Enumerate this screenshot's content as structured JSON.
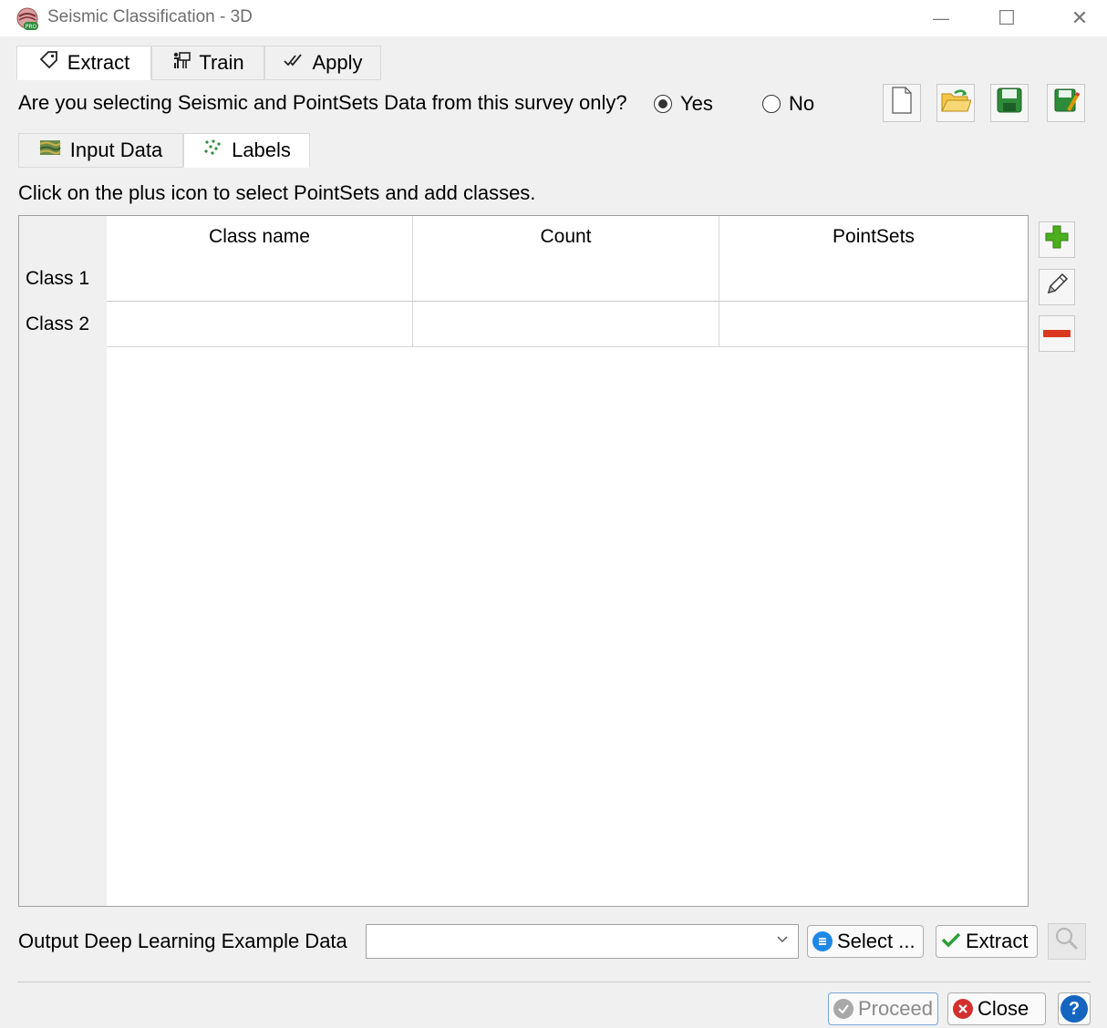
{
  "window": {
    "title": "Seismic Classification - 3D",
    "minimize_glyph": "—",
    "maximize_glyph": "☐",
    "close_glyph": "✕"
  },
  "main_tabs": [
    {
      "label": "Extract",
      "icon": "tag-icon",
      "active": true
    },
    {
      "label": "Train",
      "icon": "train-icon",
      "active": false
    },
    {
      "label": "Apply",
      "icon": "double-check-icon",
      "active": false
    }
  ],
  "survey_question": {
    "text": "Are you selecting Seismic and PointSets Data from this survey only?",
    "options": [
      {
        "label": "Yes",
        "checked": true
      },
      {
        "label": "No",
        "checked": false
      }
    ]
  },
  "toolbar": {
    "buttons": [
      "new-file-icon",
      "open-folder-icon",
      "save-icon",
      "save-as-icon"
    ]
  },
  "sub_tabs": [
    {
      "label": "Input Data",
      "icon": "seismic-data-icon",
      "active": false
    },
    {
      "label": "Labels",
      "icon": "pointset-dots-icon",
      "active": true
    }
  ],
  "instruction": "Click on the plus icon to select PointSets and add classes.",
  "table": {
    "columns": [
      "Class name",
      "Count",
      "PointSets"
    ],
    "rows": [
      {
        "header": "Class 1",
        "cells": [
          "",
          "",
          ""
        ]
      },
      {
        "header": "Class 2",
        "cells": [
          "",
          "",
          ""
        ]
      }
    ]
  },
  "side_buttons": [
    "add-class-icon",
    "edit-icon",
    "remove-class-icon"
  ],
  "output": {
    "label": "Output Deep Learning Example Data",
    "value": "",
    "select_label": "Select ...",
    "extract_label": "Extract"
  },
  "footer": {
    "proceed_label": "Proceed",
    "close_label": "Close",
    "help_glyph": "?"
  },
  "colors": {
    "accent_green": "#4caf1e",
    "remove_red": "#d9381e",
    "help_blue": "#1565c0",
    "close_red": "#d32f2f"
  }
}
